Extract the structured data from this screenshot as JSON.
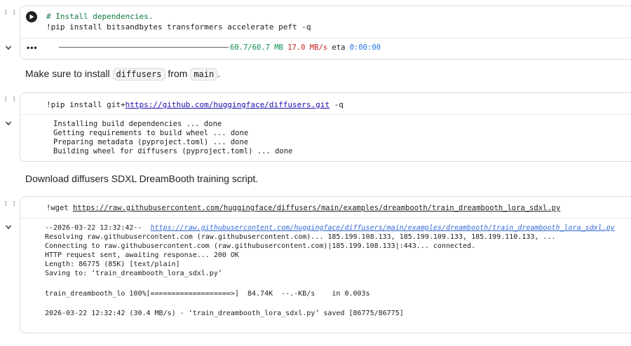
{
  "cells": {
    "cell1": {
      "exec_count": "[ ]",
      "code_comment": "# Install dependencies.",
      "code_line2": "!pip install bitsandbytes transformers accelerate peft -q",
      "output_progress": "60.7/60.7 MB",
      "output_speed": "17.0 MB/s",
      "output_eta_label": "eta",
      "output_eta": "0:00:00"
    },
    "markdown1": {
      "prefix": "Make sure to install ",
      "code1": "diffusers",
      "middle": " from ",
      "code2": "main",
      "suffix": "."
    },
    "cell2": {
      "exec_count": "[ ]",
      "code_prefix": "!pip install git+",
      "code_url": "https://github.com/huggingface/diffusers.git",
      "code_suffix": " -q",
      "output_lines": [
        "Installing build dependencies ... done",
        "Getting requirements to build wheel ... done",
        "Preparing metadata (pyproject.toml) ... done",
        "Building wheel for diffusers (pyproject.toml) ... done"
      ]
    },
    "markdown2": {
      "text": "Download diffusers SDXL DreamBooth training script."
    },
    "cell3": {
      "exec_count": "[ ]",
      "code_prefix": "!wget ",
      "code_url": "https://raw.githubusercontent.com/huggingface/diffusers/main/examples/dreambooth/train_dreambooth_lora_sdxl.py",
      "output_line1_prefix": "--2026-03-22 12:32:42--  ",
      "output_line1_url": "https://raw.githubusercontent.com/huggingface/diffusers/main/examples/dreambooth/train_dreambooth_lora_sdxl.py",
      "output_line2": "Resolving raw.githubusercontent.com (raw.githubusercontent.com)... 185.199.108.133, 185.199.109.133, 185.199.110.133, ...",
      "output_line3": "Connecting to raw.githubusercontent.com (raw.githubusercontent.com)|185.199.108.133|:443... connected.",
      "output_line4": "HTTP request sent, awaiting response... 200 OK",
      "output_line5": "Length: 86775 (85K) [text/plain]",
      "output_line6": "Saving to: ‘train_dreambooth_lora_sdxl.py’",
      "output_line7": "train_dreambooth_lo 100%[===================>]  84.74K  --.-KB/s    in 0.003s",
      "output_line8": "2026-03-22 12:32:42 (30.4 MB/s) - ‘train_dreambooth_lora_sdxl.py’ saved [86775/86775]"
    }
  }
}
